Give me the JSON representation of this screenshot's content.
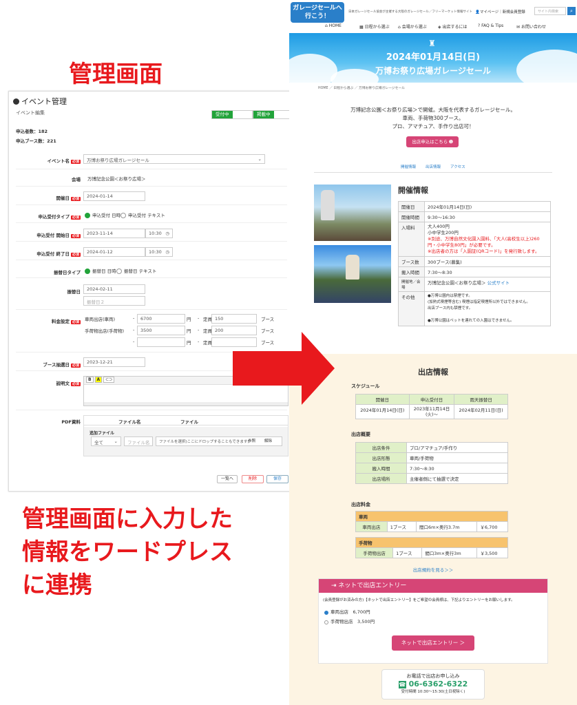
{
  "headings": {
    "admin": "管理画面",
    "caption": [
      "管理画面に入力した",
      "情報をワードプレス",
      "に連携"
    ]
  },
  "admin": {
    "title": "イベント管理",
    "subtitle": "イベント編集",
    "toggle_reception": "受付中",
    "toggle_published": "掲載中",
    "applicant_count": "申込者数：182",
    "booth_count": "申込ブース数：221",
    "required": "必須",
    "fields": {
      "event_name_label": "イベント名",
      "event_name_value": "万博お祭り広場ガレージセール",
      "venue_label": "会場",
      "venue_value": "万博記念公園＜お祭り広場＞",
      "date_label": "開催日",
      "date_value": "2024-01-14",
      "reception_type_label": "申込受付タイプ",
      "opt_datetime": "申込受付 日時",
      "opt_text": "申込受付 テキスト",
      "reception_start_label": "申込受付 開始日",
      "reception_start_date": "2023-11-14",
      "reception_start_time": "10:30",
      "reception_end_label": "申込受付 終了日",
      "reception_end_date": "2024-01-12",
      "reception_end_time": "10:30",
      "postpone_type_label": "振替日タイプ",
      "postpone_opt_datetime": "振替日 日時",
      "postpone_opt_text": "振替日 テキスト",
      "postpone_label": "振替日",
      "postpone_value": "2024-02-11",
      "postpone_placeholder2": "振替日２",
      "fee_label": "料金設定",
      "fee_rows": [
        {
          "name": "車両出店(車両)",
          "price": "6700",
          "unit": "円",
          "cap_label": "定員",
          "cap": "150",
          "booth": "ブース"
        },
        {
          "name": "手荷物出店(手荷物)",
          "price": "3500",
          "unit": "円",
          "cap_label": "定員",
          "cap": "200",
          "booth": "ブース"
        },
        {
          "name": "",
          "price": "",
          "unit": "円",
          "cap_label": "定員",
          "cap": "",
          "booth": "ブース"
        }
      ],
      "booth_date_label": "ブース抽選日",
      "booth_date_value": "2023-12-21",
      "desc_label": "説明文",
      "pdf_label": "PDF資料",
      "file_name_col": "ファイル名",
      "file_col": "ファイル",
      "add_file": "追加ファイル",
      "select_all": "全て",
      "file_name_ph": "ファイル名",
      "drop_text": "ファイルを選択(ここにドロップすることもできます)",
      "browse": "参照",
      "clear": "解除"
    },
    "buttons": {
      "list": "一覧へ",
      "delete": "削除",
      "save": "保存"
    }
  },
  "site": {
    "logo": "ガレージセールへ行こう！",
    "tagline": "日本ガレージセール協会が主催する大阪のガレージセール／フリーマーケット情報サイト",
    "mypage": "マイページ｜新規会員登録",
    "search_placeholder": "サイト内検索",
    "nav": [
      "HOME",
      "日程から選ぶ",
      "会場から選ぶ",
      "出店するには",
      "FAQ & Tips",
      "お問い合わせ"
    ],
    "hero_date": "2024年01月14日(日)",
    "hero_title": "万博お祭り広場ガレージセール",
    "breadcrumb": "HOME ／ 日程から選ぶ ／ 万博お祭り広場ガレージセール",
    "intro": [
      "万博記念公園＜お祭り広場＞で開催。大阪を代表するガレージセール。",
      "車両、手荷物300ブース。",
      "プロ、アマチュア、手作り出店可！"
    ],
    "apply_button": "出店申込はこちら",
    "tabs": [
      "開催情報",
      "出店情報",
      "アクセス"
    ],
    "info_heading": "開催情報",
    "info": {
      "date_label": "開催日",
      "date": "2024年01月14日(日)",
      "time_label": "開催時間",
      "time": "9:30～16:30",
      "fee_label": "入場料",
      "fee1": "大人400円",
      "fee2": "小中学生200円",
      "fee_note1": "※別途、万博自然文化園入園料、「大人(高校生以上)260円・小中学生80円」が必要です。",
      "fee_note2": "※出店者の方は「入園証(QRコード)」を発行致します。",
      "booths_label": "ブース数",
      "booths": "300ブース(募集)",
      "loadin_label": "搬入時間",
      "loadin": "7:30～8:30",
      "venue_label": "開催地／会場",
      "venue": "万博記念公園＜お祭り広場＞",
      "official": "公式サイト",
      "other_label": "その他",
      "other1": "●万博公園内は禁煙です。",
      "other2": "(加熱式喫煙等含む) 喫煙は指定喫煙所以外ではできません。",
      "other3": "出店ブース内も禁煙です。",
      "other4": "●万博公園はペットを連れての入園はできません。"
    },
    "vendor_heading": "出店情報",
    "schedule_heading": "スケジュール",
    "schedule": {
      "h1": "開催日",
      "h2": "申込受付日",
      "h3": "雨天振替日",
      "v1": "2024年01月14日(日)",
      "v2a": "2023年11月14日",
      "v2b": "(火)～",
      "v3": "2024年02月11日(日)"
    },
    "overview_heading": "出店概要",
    "overview": [
      {
        "k": "出店条件",
        "v": "プロ/アマチュア/手作り"
      },
      {
        "k": "出店形態",
        "v": "車両/手荷物"
      },
      {
        "k": "搬入時間",
        "v": "7:30～8:30"
      },
      {
        "k": "出店場所",
        "v": "主催者側にて抽選で決定"
      }
    ],
    "pricing_heading": "出店料金",
    "pricing": [
      {
        "cat": "車両",
        "name": "車両出店",
        "unit": "1ブース",
        "size": "間口6m×奥行3.7m",
        "price": "￥6,700"
      },
      {
        "cat": "手荷物",
        "name": "手荷物出店",
        "unit": "1ブース",
        "size": "間口3m×奥行3m",
        "price": "￥3,500"
      }
    ],
    "rules_link": "出店規約を見る＞＞",
    "entry_heading": "ネットで出店エントリー",
    "entry_note": "(会員登録がお済みの方)【ネットで出店エントリー】をご希望の会員様は、下記よりエントリーをお願いします。",
    "entry_opts": [
      {
        "name": "車両出店",
        "price": "6,700円"
      },
      {
        "name": "手荷物出店",
        "price": "3,500円"
      }
    ],
    "entry_button": "ネットで出店エントリー ＞",
    "phone_title": "お電話で出店お申し込み",
    "phone": "06-6362-6322",
    "phone_hours": "受付時間 10:30～15:30(土日祝除く)"
  },
  "colors": {
    "accent_red": "#e8191d",
    "brand_blue": "#2a7fc9",
    "entry_pink": "#d64576",
    "status_green": "#22a33a",
    "table_header_green": "#e0f0c8",
    "pricing_orange": "#f7c36e"
  },
  "icons": [
    "arrow-right-icon",
    "home-icon",
    "search-icon",
    "user-icon",
    "phone-icon",
    "entry-icon",
    "tower-icon"
  ]
}
